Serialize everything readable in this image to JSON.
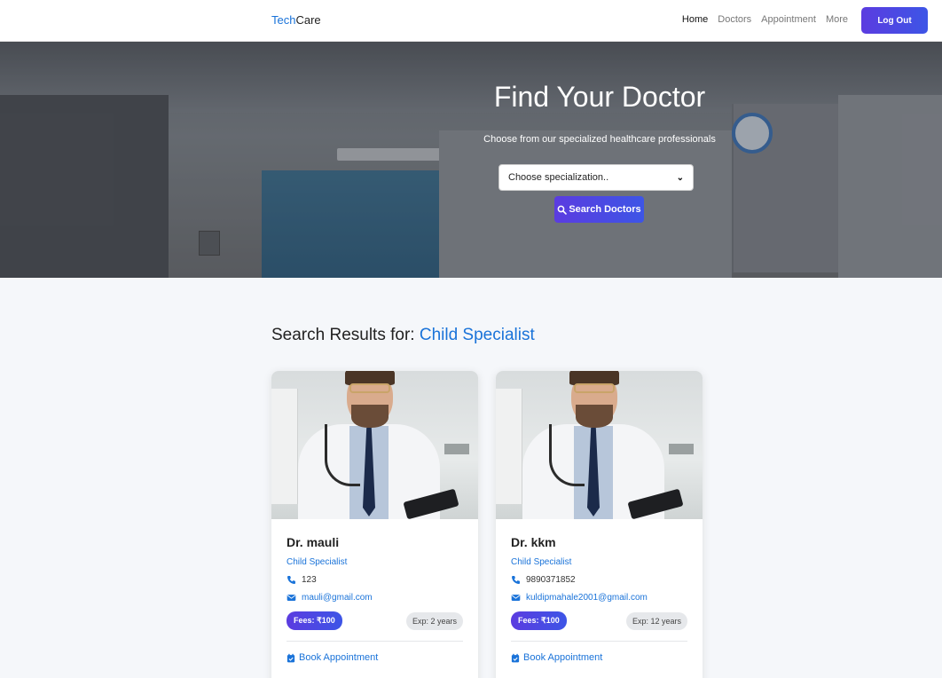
{
  "navbar": {
    "brand_part1": "Tech",
    "brand_part2": "Care",
    "links": [
      "Home",
      "Doctors",
      "Appointment",
      "More"
    ],
    "logout_label": "Log Out"
  },
  "hero": {
    "title": "Find Your Doctor",
    "subtitle": "Choose from our specialized healthcare professionals",
    "select_value": "Choose specialization..",
    "search_label": "Search Doctors"
  },
  "results": {
    "prefix": "Search Results for:",
    "term": "Child Specialist",
    "doctors": [
      {
        "name": "Dr. mauli",
        "specialization": "Child Specialist",
        "phone": "123",
        "email": "mauli@gmail.com",
        "fees": "Fees: ₹100",
        "experience": "Exp: 2 years",
        "book_label": "Book Appointment"
      },
      {
        "name": "Dr. kkm",
        "specialization": "Child Specialist",
        "phone": "9890371852",
        "email": "kuldipmahale2001@gmail.com",
        "fees": "Fees: ₹100",
        "experience": "Exp: 12 years",
        "book_label": "Book Appointment"
      }
    ]
  },
  "colors": {
    "accent": "#1a73d9",
    "button_gradient_start": "#5b3ce0",
    "button_gradient_end": "#3d55e6"
  }
}
